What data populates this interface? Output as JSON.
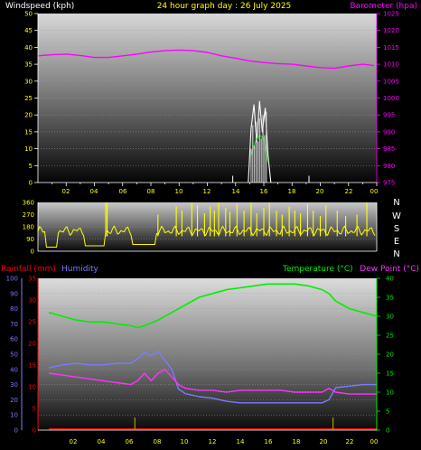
{
  "header": {
    "wind_label": "Windspeed (kph)",
    "title": "24 hour graph day : 26 July 2025",
    "baro_label": "Barometer (hpa)"
  },
  "legend_bottom": {
    "rain_label": "Rainfall (mm)",
    "humidity_label": "Humidity",
    "temp_label": "Temperature (°C)",
    "dew_label": "Dew Point (°C)"
  },
  "direction_labels": [
    "N",
    "W",
    "S",
    "E",
    "N"
  ],
  "x_ticks": [
    "02",
    "04",
    "06",
    "08",
    "10",
    "12",
    "14",
    "16",
    "18",
    "20",
    "22",
    "00"
  ],
  "colors": {
    "wind": "#ffffff",
    "gust": "#00cc00",
    "barometer": "#ff00ff",
    "direction": "#ffff00",
    "rain": "#ff0000",
    "humidity": "#7b7bff",
    "temperature": "#00ee00",
    "dewpoint": "#ff33ff"
  },
  "chart_data": [
    {
      "type": "line",
      "title": "24 hour graph day : 26 July 2025",
      "x_range": [
        0,
        24
      ],
      "left_axis": {
        "label": "Windspeed (kph)",
        "ylim": [
          0,
          50
        ],
        "ticks": [
          0,
          5,
          10,
          15,
          20,
          25,
          30,
          35,
          40,
          45,
          50
        ]
      },
      "right_axis": {
        "label": "Barometer (hpa)",
        "ylim": [
          975,
          1025
        ],
        "ticks": [
          975,
          980,
          985,
          990,
          995,
          1000,
          1005,
          1010,
          1015,
          1020,
          1025
        ]
      },
      "series": [
        {
          "name": "Barometer (hpa)",
          "axis": "right",
          "x": [
            0,
            1,
            2,
            3,
            4,
            5,
            6,
            7,
            8,
            9,
            10,
            11,
            12,
            13,
            14,
            15,
            16,
            17,
            18,
            19,
            20,
            21,
            22,
            23,
            23.8
          ],
          "values": [
            1012.5,
            1012.8,
            1013,
            1012.6,
            1012,
            1012,
            1012.5,
            1013,
            1013.6,
            1014,
            1014.2,
            1014,
            1013.5,
            1012.5,
            1011.8,
            1011,
            1010.5,
            1010.2,
            1010,
            1009.5,
            1009,
            1008.8,
            1009.5,
            1010,
            1009.6
          ]
        },
        {
          "name": "Windspeed",
          "axis": "left",
          "x": [
            14.9,
            15.1,
            15.3,
            15.5,
            15.7,
            15.9,
            16.1,
            16.3,
            16.5
          ],
          "values": [
            0,
            16,
            23,
            12,
            24,
            15,
            22,
            8,
            0
          ]
        },
        {
          "name": "Gust",
          "axis": "left",
          "x": [
            15.1,
            15.4,
            15.7,
            16.0,
            16.3
          ],
          "values": [
            8,
            12,
            14,
            13,
            6
          ]
        }
      ]
    },
    {
      "type": "scatter",
      "x_range": [
        0,
        24
      ],
      "ylim": [
        0,
        360
      ],
      "ticks": [
        0,
        90,
        180,
        270,
        360
      ],
      "series": [
        {
          "name": "Wind Direction",
          "baseline": 150,
          "spikes_x": [
            4.8,
            4.9,
            8.5,
            9.8,
            10.2,
            10.9,
            11.3,
            11.8,
            12.2,
            12.5,
            12.8,
            13.3,
            13.6,
            14.1,
            14.6,
            15.1,
            15.5,
            16.0,
            16.4,
            16.9,
            17.3,
            17.8,
            18.2,
            18.6,
            19.1,
            19.5,
            20.0,
            20.4,
            21.2,
            21.8,
            22.6,
            23.3
          ],
          "spikes_to": [
            360,
            360,
            270,
            330,
            300,
            360,
            340,
            280,
            330,
            300,
            360,
            320,
            290,
            350,
            300,
            360,
            280,
            320,
            360,
            300,
            270,
            330,
            300,
            280,
            350,
            300,
            260,
            340,
            300,
            260,
            270,
            360
          ],
          "low_runs": [
            [
              0.6,
              1.4,
              30
            ],
            [
              3.3,
              4.7,
              40
            ],
            [
              6.7,
              8.3,
              50
            ]
          ]
        }
      ]
    },
    {
      "type": "line",
      "x_range": [
        0,
        24
      ],
      "humidity_axis": {
        "label": "Humidity",
        "ylim": [
          0,
          100
        ],
        "ticks": [
          0,
          10,
          20,
          30,
          40,
          50,
          60,
          70,
          80,
          90,
          100
        ]
      },
      "rain_axis": {
        "label": "Rainfall (mm)",
        "ylim": [
          0,
          35
        ],
        "ticks": [
          0,
          5,
          10,
          15,
          20,
          25,
          30,
          35
        ]
      },
      "temp_axis": {
        "label": "Temperature (°C)",
        "ylim": [
          0,
          40
        ],
        "ticks": [
          0,
          5,
          10,
          15,
          20,
          25,
          30,
          35,
          40
        ]
      },
      "series": [
        {
          "name": "Temperature (°C)",
          "axis": "temp",
          "x": [
            0,
            1,
            2,
            3,
            4,
            5,
            6,
            6.5,
            7,
            8,
            9,
            10,
            11,
            12,
            13,
            14,
            15,
            16,
            17,
            18,
            19,
            20,
            20.5,
            21,
            22,
            23,
            24
          ],
          "values": [
            31,
            30,
            29,
            28.5,
            28.5,
            28,
            27.5,
            27,
            27.5,
            29,
            31,
            33,
            35,
            36,
            37,
            37.5,
            38,
            38.5,
            38.5,
            38.5,
            38,
            37,
            36,
            34,
            32,
            31,
            30
          ]
        },
        {
          "name": "Humidity",
          "axis": "humidity",
          "x": [
            0,
            1,
            2,
            3,
            4,
            5,
            6,
            6.5,
            7,
            7.5,
            8,
            8.5,
            9,
            9.5,
            10,
            11,
            12,
            13,
            14,
            15,
            16,
            17,
            18,
            19,
            20,
            20.5,
            21,
            22,
            23,
            24
          ],
          "values": [
            41,
            43,
            44,
            43,
            43,
            44,
            44,
            47,
            51,
            49,
            52,
            46,
            40,
            27,
            24,
            22,
            21,
            19,
            18,
            18,
            18,
            18,
            18,
            18,
            18,
            20,
            28,
            29,
            30,
            30
          ]
        },
        {
          "name": "Dew Point (°C)",
          "axis": "temp",
          "x": [
            0,
            1,
            2,
            3,
            4,
            5,
            6,
            6.5,
            7,
            7.5,
            8,
            8.5,
            9,
            9.5,
            10,
            11,
            12,
            13,
            14,
            15,
            16,
            17,
            18,
            19,
            20,
            20.5,
            21,
            22,
            23,
            24
          ],
          "values": [
            15,
            14.5,
            14,
            13.5,
            13,
            12.5,
            12,
            13,
            15,
            13,
            15,
            16,
            14,
            12,
            11,
            10.5,
            10.5,
            10,
            10.5,
            10.5,
            10.5,
            10.5,
            10,
            10,
            10,
            11,
            10,
            9.5,
            9.5,
            9.5
          ]
        },
        {
          "name": "Rainfall (mm)",
          "axis": "rain",
          "x": [
            0,
            24
          ],
          "values": [
            0,
            0
          ]
        }
      ],
      "markers_x": [
        6.3,
        20.8
      ]
    }
  ]
}
